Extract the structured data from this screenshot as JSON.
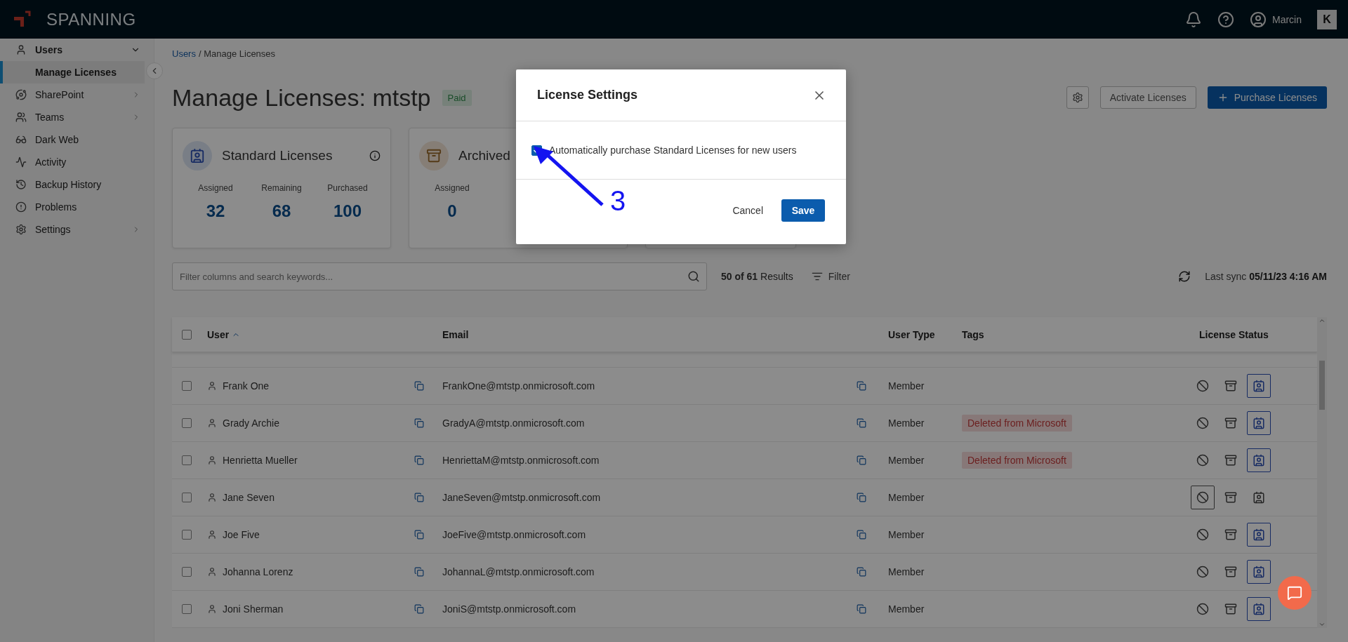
{
  "topbar": {
    "brand": "SPANNING",
    "user": "Marcin",
    "app_badge": "K"
  },
  "sidebar": {
    "items": [
      {
        "kind": "group",
        "label": "Users",
        "expanded": true,
        "children": [
          {
            "label": "Manage Licenses",
            "selected": true
          }
        ]
      },
      {
        "kind": "group",
        "label": "SharePoint",
        "expanded": false
      },
      {
        "kind": "group",
        "label": "Teams",
        "expanded": false
      },
      {
        "kind": "link",
        "label": "Dark Web"
      },
      {
        "kind": "link",
        "label": "Activity"
      },
      {
        "kind": "link",
        "label": "Backup History"
      },
      {
        "kind": "link",
        "label": "Problems"
      },
      {
        "kind": "group",
        "label": "Settings",
        "expanded": false
      }
    ]
  },
  "breadcrumb": {
    "link": "Users",
    "current": "/ Manage Licenses"
  },
  "page_title": "Manage Licenses: mtstp",
  "plan_badge": "Paid",
  "actions": {
    "secondary": "Activate Licenses",
    "primary": "Purchase Licenses"
  },
  "cards": [
    {
      "kind": "standard",
      "title": "Standard Licenses",
      "stats": [
        {
          "label": "Assigned",
          "value": "32"
        },
        {
          "label": "Remaining",
          "value": "68"
        },
        {
          "label": "Purchased",
          "value": "100"
        }
      ]
    },
    {
      "kind": "archived",
      "title": "Archived",
      "stats": [
        {
          "label": "Assigned",
          "value": "0"
        }
      ]
    },
    {
      "kind": "blank"
    }
  ],
  "search": {
    "placeholder": "Filter columns and search keywords..."
  },
  "results": {
    "shown": "50 of 61",
    "label": "Results"
  },
  "filter": "Filter",
  "sync": {
    "label": "Last sync",
    "time": "05/11/23 4:16 AM"
  },
  "table": {
    "select_all_checked": false,
    "columns": [
      "User",
      "Email",
      "User Type",
      "Tags",
      "License Status"
    ],
    "rows": [
      {
        "user": "Frank One",
        "email": "FrankOne@mtstp.onmicrosoft.com",
        "type": "Member",
        "checked": false,
        "license_status": [
          {
            "selected": false
          },
          {
            "selected": false
          },
          {
            "selected": true
          }
        ]
      },
      {
        "user": "Grady Archie",
        "email": "GradyA@mtstp.onmicrosoft.com",
        "type": "Member",
        "tag": "Deleted from Microsoft",
        "checked": false,
        "license_status": [
          {
            "selected": false
          },
          {
            "selected": false
          },
          {
            "selected": true
          }
        ]
      },
      {
        "user": "Henrietta Mueller",
        "email": "HenriettaM@mtstp.onmicrosoft.com",
        "type": "Member",
        "tag": "Deleted from Microsoft",
        "checked": false,
        "license_status": [
          {
            "selected": false
          },
          {
            "selected": false
          },
          {
            "selected": true
          }
        ]
      },
      {
        "user": "Jane Seven",
        "email": "JaneSeven@mtstp.onmicrosoft.com",
        "type": "Member",
        "checked": false,
        "license_status": [
          {
            "selected": true
          },
          {
            "selected": false
          },
          {
            "selected": false
          }
        ]
      },
      {
        "user": "Joe Five",
        "email": "JoeFive@mtstp.onmicrosoft.com",
        "type": "Member",
        "checked": false,
        "license_status": [
          {
            "selected": false
          },
          {
            "selected": false
          },
          {
            "selected": true
          }
        ]
      },
      {
        "user": "Johanna Lorenz",
        "email": "JohannaL@mtstp.onmicrosoft.com",
        "type": "Member",
        "checked": false,
        "license_status": [
          {
            "selected": false
          },
          {
            "selected": false
          },
          {
            "selected": true
          }
        ]
      },
      {
        "user": "Joni Sherman",
        "email": "JoniS@mtstp.onmicrosoft.com",
        "type": "Member",
        "checked": false,
        "license_status": [
          {
            "selected": false
          },
          {
            "selected": false
          },
          {
            "selected": true
          }
        ]
      }
    ]
  },
  "dialog": {
    "title": "License Settings",
    "option": {
      "label": "Automatically purchase Standard Licenses for new users",
      "checked": true
    },
    "cancel": "Cancel",
    "save": "Save"
  },
  "annotation": "3"
}
